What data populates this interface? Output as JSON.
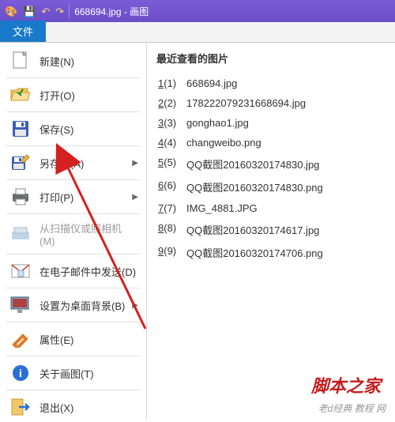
{
  "titlebar": {
    "title": "668694.jpg - 画图"
  },
  "file_tab": "文件",
  "menu": {
    "new": "新建(N)",
    "open": "打开(O)",
    "save": "保存(S)",
    "save_as": "另存为(A)",
    "print": "打印(P)",
    "from_scanner": "从扫描仪或照相机(M)",
    "send_email": "在电子邮件中发送(D)",
    "set_wallpaper": "设置为桌面背景(B)",
    "properties": "属性(E)",
    "about": "关于画图(T)",
    "exit": "退出(X)"
  },
  "recent": {
    "title": "最近查看的图片",
    "items": [
      {
        "num": "1(1)",
        "name": "668694.jpg"
      },
      {
        "num": "2(2)",
        "name": "178222079231668694.jpg"
      },
      {
        "num": "3(3)",
        "name": "gonghao1.jpg"
      },
      {
        "num": "4(4)",
        "name": "changweibo.png"
      },
      {
        "num": "5(5)",
        "name": "QQ截图20160320174830.jpg"
      },
      {
        "num": "6(6)",
        "name": "QQ截图20160320174830.png"
      },
      {
        "num": "7(7)",
        "name": "IMG_4881.JPG"
      },
      {
        "num": "8(8)",
        "name": "QQ截图20160320174617.jpg"
      },
      {
        "num": "9(9)",
        "name": "QQ截图20160320174706.png"
      }
    ]
  },
  "watermark1": "脚本之家",
  "watermark2": "老d经典 教程 网"
}
